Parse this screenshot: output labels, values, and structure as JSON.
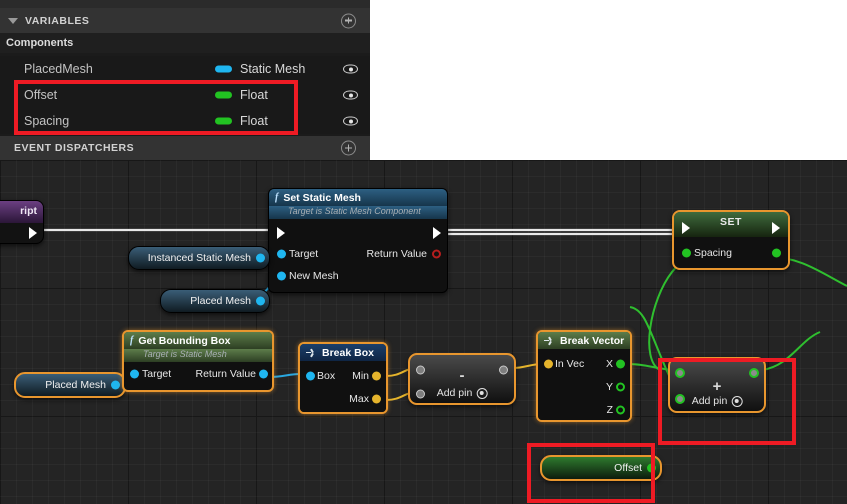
{
  "panel": {
    "variables_header": {
      "label": "VARIABLES",
      "add_icon": "plus-circle-icon",
      "collapse_icon": "triangle-down-icon"
    },
    "components_row": {
      "label": "Components",
      "expand_icon": "triangle-right-icon"
    },
    "variables": [
      {
        "name": "PlacedMesh",
        "type": "Static Mesh",
        "pin_color": "#1fb6f0",
        "visibility_icon": "eye-icon"
      },
      {
        "name": "Offset",
        "type": "Float",
        "pin_color": "#22c322",
        "visibility_icon": "eye-icon"
      },
      {
        "name": "Spacing",
        "type": "Float",
        "pin_color": "#22c322",
        "visibility_icon": "eye-icon"
      }
    ],
    "event_dispatchers_header": {
      "label": "EVENT DISPATCHERS",
      "add_icon": "plus-circle-icon"
    }
  },
  "annotations": {
    "color": "#ee1b24",
    "boxes": [
      {
        "name": "variables-offset-spacing-highlight"
      },
      {
        "name": "add-node-highlight"
      },
      {
        "name": "offset-getter-highlight"
      }
    ]
  },
  "graph": {
    "event_node": {
      "title": "ript"
    },
    "set_static_mesh": {
      "title": "Set Static Mesh",
      "subtitle": "Target is Static Mesh Component",
      "inputs": [
        "Target",
        "New Mesh"
      ],
      "outputs": [
        "Return Value"
      ],
      "function_icon": "f-icon"
    },
    "instanced_static_mesh_getter": {
      "label": "Instanced Static Mesh"
    },
    "placed_mesh_getter_top": {
      "label": "Placed Mesh"
    },
    "placed_mesh_getter_bottom": {
      "label": "Placed Mesh"
    },
    "get_bounding_box": {
      "title": "Get Bounding Box",
      "subtitle": "Target is Static Mesh",
      "inputs": [
        "Target"
      ],
      "outputs": [
        "Return Value"
      ],
      "function_icon": "f-icon"
    },
    "break_box": {
      "title": "Break Box",
      "inputs": [
        "Box"
      ],
      "outputs": [
        "Min",
        "Max"
      ],
      "icon": "break-struct-icon"
    },
    "subtract_node": {
      "operator": "-",
      "add_pin_label": "Add pin",
      "add_pin_icon": "add-pin-icon"
    },
    "break_vector": {
      "title": "Break Vector",
      "inputs": [
        "In Vec"
      ],
      "outputs": [
        "X",
        "Y",
        "Z"
      ],
      "icon": "break-struct-icon"
    },
    "add_node": {
      "operator": "+",
      "add_pin_label": "Add pin",
      "add_pin_icon": "add-pin-icon"
    },
    "set_node": {
      "title": "SET",
      "variable_label": "Spacing"
    },
    "offset_getter": {
      "label": "Offset"
    }
  }
}
